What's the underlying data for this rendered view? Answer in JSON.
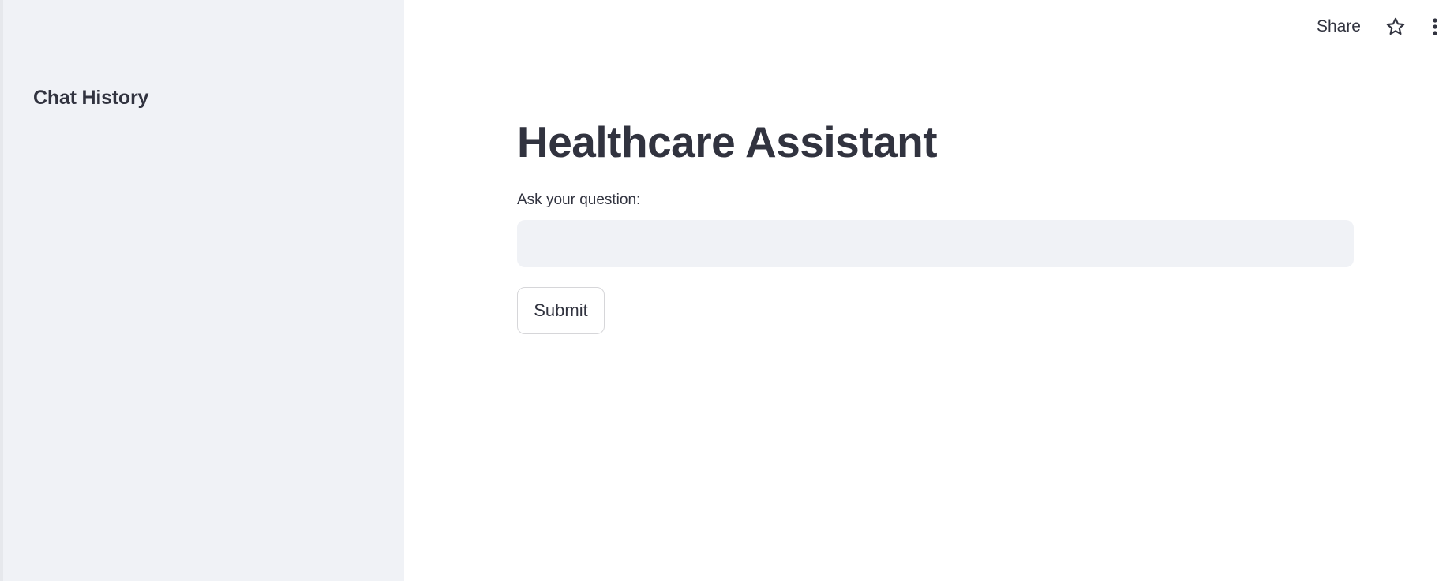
{
  "sidebar": {
    "title": "Chat History"
  },
  "toolbar": {
    "share_label": "Share",
    "star_icon": "star-outline-icon",
    "menu_icon": "vertical-ellipsis-icon"
  },
  "main": {
    "title": "Healthcare Assistant",
    "question_label": "Ask your question:",
    "question_value": "",
    "question_placeholder": "",
    "submit_label": "Submit"
  },
  "colors": {
    "sidebar_bg": "#f0f2f6",
    "text": "#31333f",
    "input_bg": "#f0f2f6",
    "background": "#ffffff"
  }
}
